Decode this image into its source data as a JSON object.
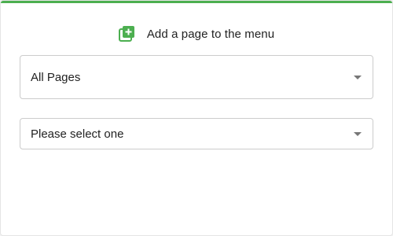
{
  "header": {
    "title": "Add a page to the menu",
    "icon": "add-page-icon",
    "icon_color": "#4caf50"
  },
  "accent_color": "#4caf50",
  "selects": [
    {
      "value": "All Pages",
      "icon": "chevron-down-icon"
    },
    {
      "value": "Please select one",
      "icon": "chevron-down-icon"
    }
  ]
}
